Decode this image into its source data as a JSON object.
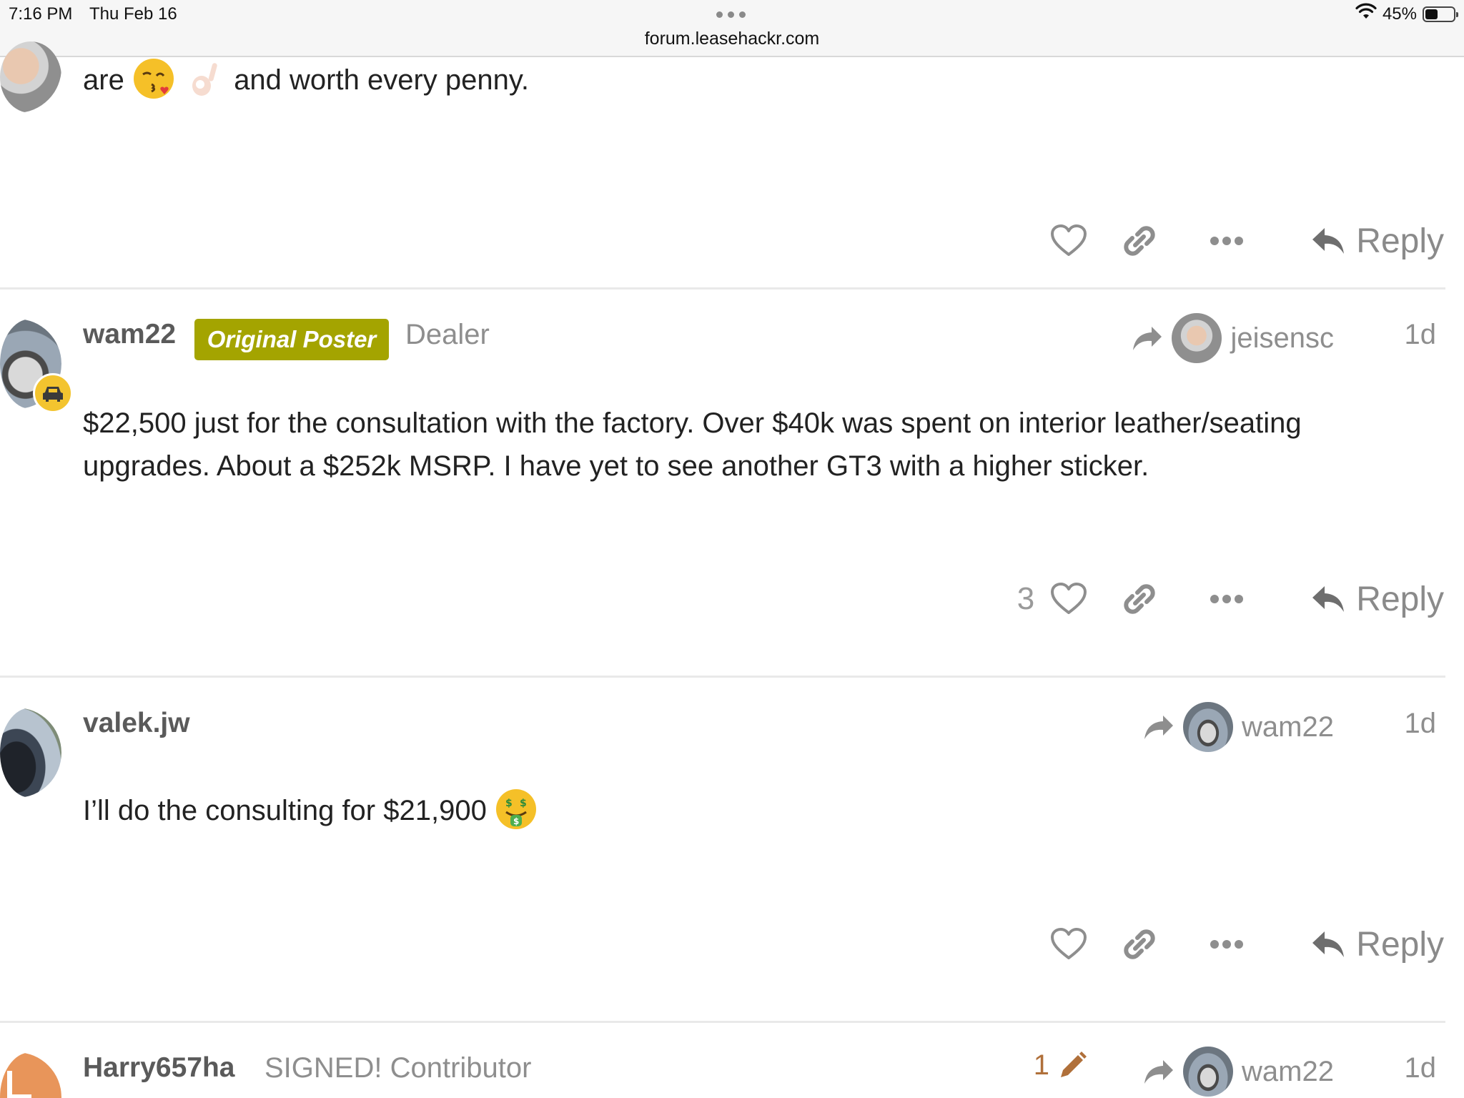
{
  "status_bar": {
    "time": "7:16 PM",
    "date": "Thu Feb 16",
    "url": "forum.leasehackr.com",
    "battery_percent": "45%",
    "battery_level": 0.45
  },
  "colors": {
    "original_poster_badge": "#a4a400",
    "muted_text": "#8e8e8e",
    "username_text": "#5a5a5a",
    "edit_count": "#b0703a"
  },
  "posts": [
    {
      "body_prefix": "are",
      "emojis": [
        "kissing-wink-emoji",
        "ok-hand-emoji"
      ],
      "body_suffix": "and worth every penny.",
      "like_count": "",
      "reply_label": "Reply"
    },
    {
      "username": "wam22",
      "badge": "Original Poster",
      "user_title": "Dealer",
      "reply_to": "jeisensc",
      "age": "1d",
      "body": "$22,500 just for the consultation with the factory. Over $40k was spent on interior leather/seating upgrades. About a $252k MSRP. I have yet to see another GT3 with a higher sticker.",
      "like_count": "3",
      "reply_label": "Reply"
    },
    {
      "username": "valek.jw",
      "reply_to": "wam22",
      "age": "1d",
      "body": "I’ll do the consulting for $21,900",
      "emoji": "money-mouth-emoji",
      "like_count": "",
      "reply_label": "Reply"
    },
    {
      "username": "Harry657ha",
      "user_title": "SIGNED! Contributor",
      "edit_count": "1",
      "reply_to": "wam22",
      "age": "1d"
    }
  ]
}
